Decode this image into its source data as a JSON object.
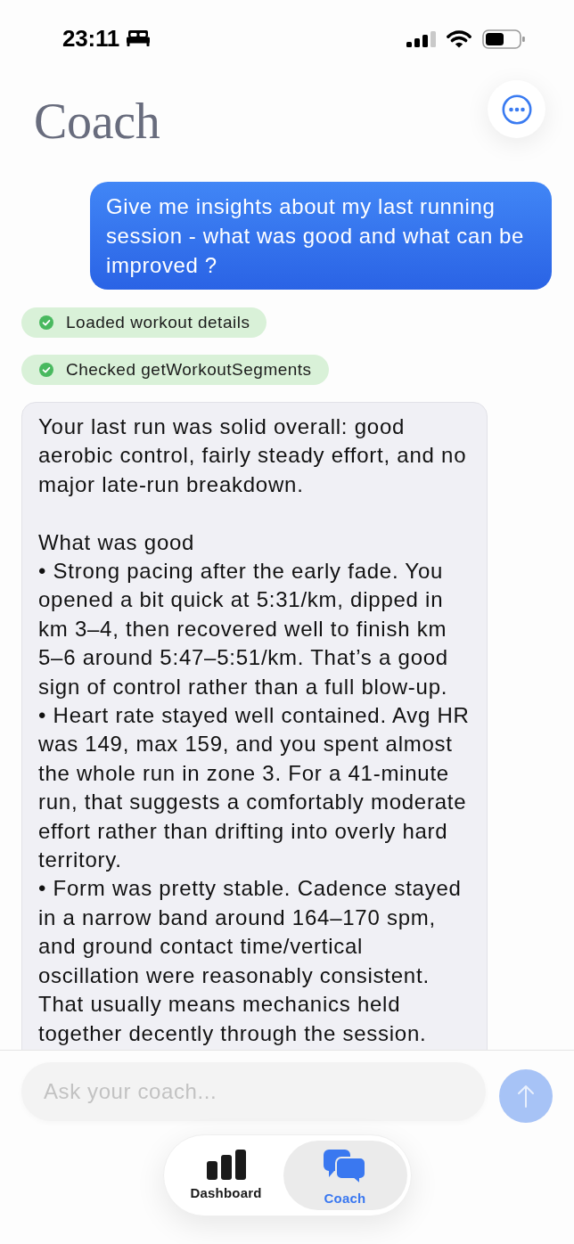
{
  "status_bar": {
    "time": "23:11"
  },
  "header": {
    "title": "Coach"
  },
  "messages": [
    {
      "kind": "user",
      "text": "Give me insights about my last running session - what was good and what can be improved ?"
    },
    {
      "kind": "tool",
      "text": "Loaded workout details",
      "done": true
    },
    {
      "kind": "tool",
      "text": "Checked getWorkoutSegments",
      "done": true
    },
    {
      "kind": "assistant",
      "blocks": [
        {
          "kind": "paragraph",
          "text": "Your last run was solid overall: good aerobic control, fairly steady effort, and no major late-run breakdown."
        },
        {
          "kind": "heading",
          "text": "What was good"
        },
        {
          "kind": "bullet",
          "text": "• Strong pacing after the early fade. You opened a bit quick at 5:31/km, dipped in km 3–4, then recovered well to finish km 5–6 around 5:47–5:51/km. That’s a good sign of control rather than a full blow-up."
        },
        {
          "kind": "bullet",
          "text": "• Heart rate stayed well contained. Avg HR was 149, max 159, and you spent almost the whole run in zone 3. For a 41-minute run, that suggests a comfortably moderate effort rather than drifting into overly hard territory."
        },
        {
          "kind": "bullet",
          "text": "• Form was pretty stable. Cadence stayed in a narrow band around 164–170 spm, and ground contact time/vertical oscillation were reasonably consistent. That usually means mechanics held together decently through the session."
        }
      ]
    }
  ],
  "composer": {
    "placeholder": "Ask your coach...",
    "send_disabled": true
  },
  "tabs": [
    {
      "label": "Dashboard",
      "selected": false
    },
    {
      "label": "Coach",
      "selected": true
    }
  ]
}
